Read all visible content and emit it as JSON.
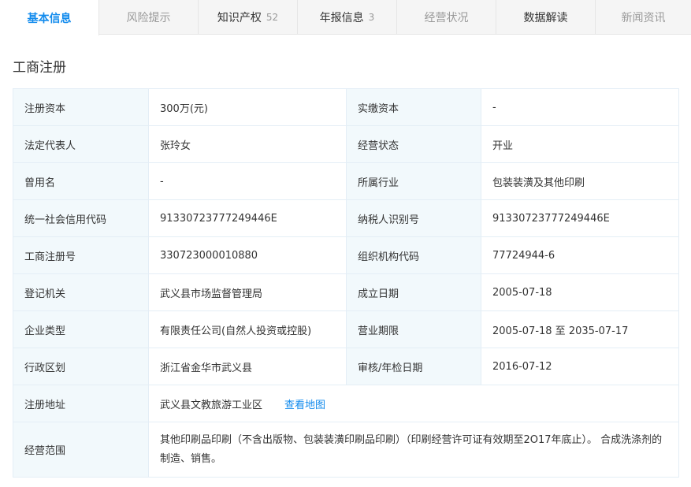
{
  "tabs": [
    {
      "label": "基本信息",
      "count": "",
      "state": "active"
    },
    {
      "label": "风险提示",
      "count": "",
      "state": "muted"
    },
    {
      "label": "知识产权",
      "count": "52",
      "state": "normal"
    },
    {
      "label": "年报信息",
      "count": "3",
      "state": "normal"
    },
    {
      "label": "经营状况",
      "count": "",
      "state": "muted"
    },
    {
      "label": "数据解读",
      "count": "",
      "state": "normal"
    },
    {
      "label": "新闻资讯",
      "count": "",
      "state": "muted"
    }
  ],
  "section_title": "工商注册",
  "rows": [
    {
      "l1": "注册资本",
      "v1": "300万(元)",
      "l2": "实缴资本",
      "v2": "-"
    },
    {
      "l1": "法定代表人",
      "v1": "张玲女",
      "l2": "经营状态",
      "v2": "开业"
    },
    {
      "l1": "曾用名",
      "v1": "-",
      "l2": "所属行业",
      "v2": "包装装潢及其他印刷"
    },
    {
      "l1": "统一社会信用代码",
      "v1": "91330723777249446E",
      "l2": "纳税人识别号",
      "v2": "91330723777249446E"
    },
    {
      "l1": "工商注册号",
      "v1": "330723000010880",
      "l2": "组织机构代码",
      "v2": "77724944-6"
    },
    {
      "l1": "登记机关",
      "v1": "武义县市场监督管理局",
      "l2": "成立日期",
      "v2": "2005-07-18"
    },
    {
      "l1": "企业类型",
      "v1": "有限责任公司(自然人投资或控股)",
      "l2": "营业期限",
      "v2": "2005-07-18 至 2035-07-17"
    },
    {
      "l1": "行政区划",
      "v1": "浙江省金华市武义县",
      "l2": "审核/年检日期",
      "v2": "2016-07-12"
    }
  ],
  "address": {
    "label": "注册地址",
    "value": "武义县文教旅游工业区",
    "link": "查看地图"
  },
  "scope": {
    "label": "经营范围",
    "value": "其他印刷品印刷（不含出版物、包装装潢印刷品印刷）（印刷经营许可证有效期至2O17年底止）。 合成洗涤剂的制造、销售。"
  },
  "colors": {
    "accent": "#128bed",
    "label_bg": "#f2f9fc",
    "border": "#e4eef6"
  }
}
